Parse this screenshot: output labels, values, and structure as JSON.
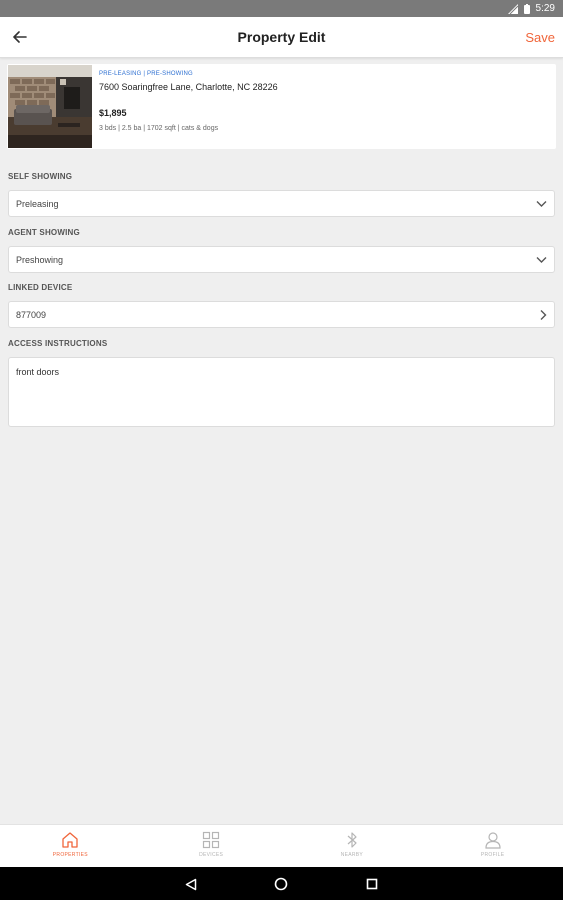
{
  "status_bar": {
    "time": "5:29"
  },
  "header": {
    "title": "Property Edit",
    "save_label": "Save"
  },
  "property": {
    "tags": "PRE-LEASING | PRE-SHOWING",
    "address": "7600 Soaringfree Lane, Charlotte, NC 28226",
    "price": "$1,895",
    "details": "3 bds | 2.5 ba | 1702 sqft | cats & dogs"
  },
  "form": {
    "self_showing": {
      "label": "SELF SHOWING",
      "value": "Preleasing"
    },
    "agent_showing": {
      "label": "AGENT SHOWING",
      "value": "Preshowing"
    },
    "linked_device": {
      "label": "LINKED DEVICE",
      "value": "877009"
    },
    "access_instructions": {
      "label": "ACCESS INSTRUCTIONS",
      "value": "front doors"
    }
  },
  "bottom_nav": {
    "items": [
      {
        "label": "PROPERTIES",
        "icon": "home-icon",
        "active": true
      },
      {
        "label": "DEVICES",
        "icon": "grid-icon",
        "active": false
      },
      {
        "label": "NEARBY",
        "icon": "bluetooth-icon",
        "active": false
      },
      {
        "label": "PROFILE",
        "icon": "person-icon",
        "active": false
      }
    ]
  },
  "colors": {
    "accent": "#f0653a",
    "tag_blue": "#2d6fd1",
    "status_bar": "#7a7a7a"
  }
}
